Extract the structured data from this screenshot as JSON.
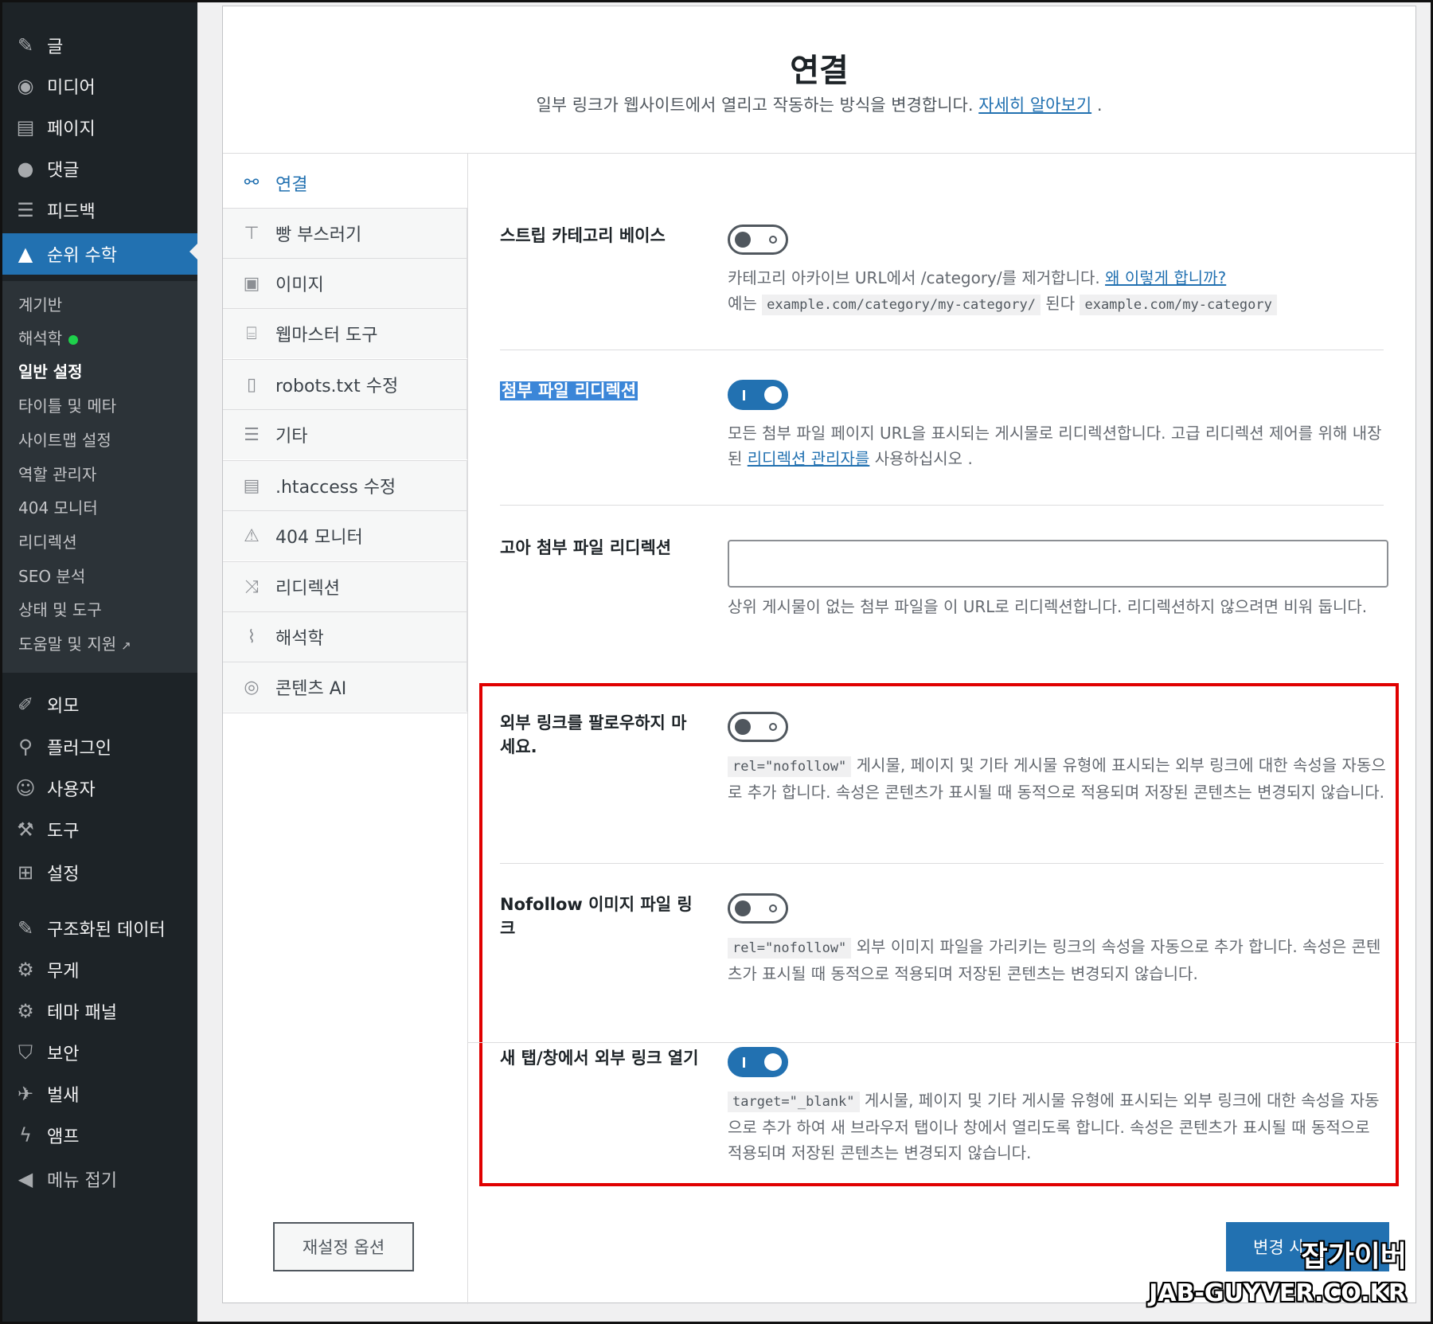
{
  "sidebar": {
    "top_items": [
      {
        "label": "글",
        "icon": "pin-icon"
      },
      {
        "label": "미디어",
        "icon": "media-icon"
      },
      {
        "label": "페이지",
        "icon": "page-icon"
      },
      {
        "label": "댓글",
        "icon": "comment-icon"
      },
      {
        "label": "피드백",
        "icon": "feedback-icon"
      },
      {
        "label": "순위 수학",
        "icon": "rankmath-icon"
      }
    ],
    "sub_items": [
      "계기반",
      "해석학",
      "일반 설정",
      "타이틀 및 메타",
      "사이트맵 설정",
      "역할 관리자",
      "404 모니터",
      "리디렉션",
      "SEO 분석",
      "상태 및 도구",
      "도움말 및 지원"
    ],
    "bottom_items": [
      {
        "label": "외모",
        "icon": "brush-icon"
      },
      {
        "label": "플러그인",
        "icon": "plugin-icon"
      },
      {
        "label": "사용자",
        "icon": "user-icon"
      },
      {
        "label": "도구",
        "icon": "wrench-icon"
      },
      {
        "label": "설정",
        "icon": "settings-icon"
      },
      {
        "label": "구조화된 데이터",
        "icon": "pin-icon"
      },
      {
        "label": "무게",
        "icon": "gear-icon"
      },
      {
        "label": "테마 패널",
        "icon": "gear-icon"
      },
      {
        "label": "보안",
        "icon": "shield-icon"
      },
      {
        "label": "벌새",
        "icon": "hummingbird-icon"
      },
      {
        "label": "앰프",
        "icon": "amp-icon"
      },
      {
        "label": "메뉴 접기",
        "icon": "collapse-icon"
      }
    ],
    "active_color": "#2271b1"
  },
  "header": {
    "title": "연결",
    "subtitle": "일부 링크가 웹사이트에서 열리고 작동하는 방식을 변경합니다.",
    "learn_more": "자세히 알아보기",
    "period": "."
  },
  "tabs": [
    {
      "label": "연결",
      "icon": "link-icon"
    },
    {
      "label": "빵 부스러기",
      "icon": "signpost-icon"
    },
    {
      "label": "이미지",
      "icon": "images-icon"
    },
    {
      "label": "웹마스터 도구",
      "icon": "toolbox-icon"
    },
    {
      "label": "robots.txt 수정",
      "icon": "file-o-icon"
    },
    {
      "label": "기타",
      "icon": "list-icon"
    },
    {
      "label": ".htaccess 수정",
      "icon": "document-icon"
    },
    {
      "label": "404 모니터",
      "icon": "warning-icon"
    },
    {
      "label": "리디렉션",
      "icon": "shuffle-icon"
    },
    {
      "label": "해석학",
      "icon": "chart-icon"
    },
    {
      "label": "콘텐츠 AI",
      "icon": "fingerprint-icon"
    }
  ],
  "settings": {
    "strip_category": {
      "label": "스트립 카테고리 베이스",
      "desc_1": "카테고리 아카이브 URL에서 /category/를 제거합니다.",
      "why_link": "왜 이렇게 합니까?",
      "example_prefix": "예는",
      "example_from": "example.com/category/my-category/",
      "example_mid": "된다",
      "example_to": "example.com/my-category",
      "enabled": false
    },
    "attachment_redirect": {
      "label": "첨부 파일 리디렉션",
      "desc_1": "모든 첨부 파일 페이지 URL을 표시되는 게시물로 리디렉션합니다. 고급 리디렉션 제어를 위해 내장된",
      "link": "리디렉션 관리자를",
      "desc_2": "사용하십시오 .",
      "enabled": true
    },
    "orphan_redirect": {
      "label": "고아 첨부 파일 리디렉션",
      "value": "",
      "desc": "상위 게시물이 없는 첨부 파일을 이 URL로 리디렉션합니다. 리디렉션하지 않으려면 비워 둡니다."
    },
    "nofollow_external": {
      "label": "외부 링크를 팔로우하지 마세요.",
      "code": "rel=\"nofollow\"",
      "desc": "게시물, 페이지 및 기타 게시물 유형에 표시되는 외부 링크에 대한 속성을 자동으로 추가 합니다. 속성은 콘텐츠가 표시될 때 동적으로 적용되며 저장된 콘텐츠는 변경되지 않습니다.",
      "enabled": false
    },
    "nofollow_images": {
      "label": "Nofollow 이미지 파일 링크",
      "code": "rel=\"nofollow\"",
      "desc": "외부 이미지 파일을 가리키는 링크의 속성을 자동으로 추가 합니다. 속성은 콘텐츠가 표시될 때 동적으로 적용되며 저장된 콘텐츠는 변경되지 않습니다.",
      "enabled": false
    },
    "new_tab": {
      "label": "새 탭/창에서 외부 링크 열기",
      "code": "target=\"_blank\"",
      "desc": "게시물, 페이지 및 기타 게시물 유형에 표시되는 외부 링크에 대한 속성을 자동으로 추가 하여 새 브라우저 탭이나 창에서 열리도록 합니다. 속성은 콘텐츠가 표시될 때 동적으로 적용되며 저장된 콘텐츠는 변경되지 않습니다.",
      "enabled": true
    }
  },
  "footer": {
    "reset_label": "재설정 옵션",
    "save_label": "변경 사"
  },
  "watermark": {
    "korean": "잡가이버",
    "domain": "JAB-GUYVER.CO.KR"
  },
  "colors": {
    "accent": "#2271b1",
    "highlight_box": "#e00000",
    "sidebar_bg": "#1d2327"
  }
}
